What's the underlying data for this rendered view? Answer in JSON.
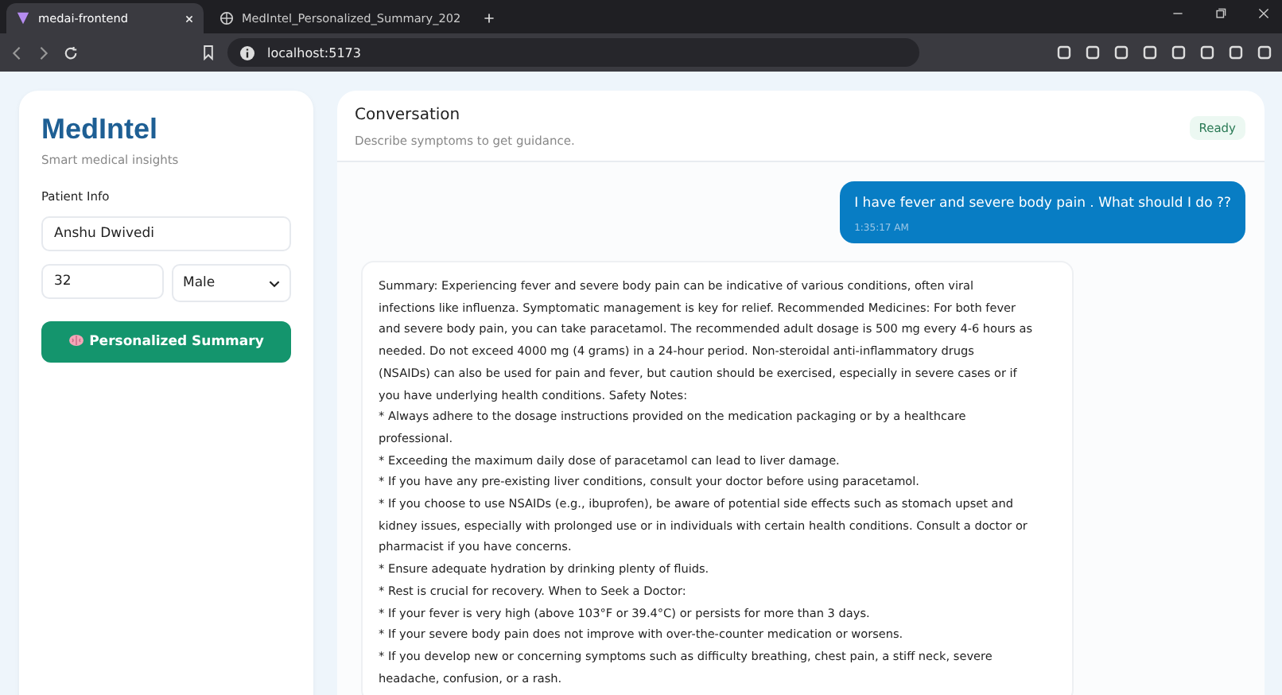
{
  "browser": {
    "tabs": [
      {
        "title": "medai-frontend",
        "selected": true
      },
      {
        "title": "MedIntel_Personalized_Summary_202",
        "selected": false
      }
    ],
    "address": "localhost:5173"
  },
  "sidebar": {
    "brand": "MedIntel",
    "tagline": "Smart medical insights",
    "section_label": "Patient Info",
    "name_value": "Anshu Dwivedi",
    "age_value": "32",
    "gender_value": "Male",
    "button_label": "Personalized Summary"
  },
  "conversation": {
    "title": "Conversation",
    "subtitle": "Describe symptoms to get guidance.",
    "status": "Ready",
    "messages": [
      {
        "kind": "user",
        "lines": [
          "I have fever and severe body pain . What should I do ??"
        ],
        "time": "1:35:17 AM"
      },
      {
        "kind": "assistant",
        "lines": [
          "Summary: Experiencing fever and severe body pain can be indicative of various conditions, often viral",
          "infections like influenza. Symptomatic management is key for relief. Recommended Medicines: For both fever",
          "and severe body pain, you can take paracetamol. The recommended adult dosage is 500 mg every 4-6 hours as",
          "needed. Do not exceed 4000 mg (4 grams) in a 24-hour period. Non-steroidal anti-inflammatory drugs",
          "(NSAIDs) can also be used for pain and fever, but caution should be exercised, especially in severe cases or if",
          "you have underlying health conditions. Safety Notes:",
          "* Always adhere to the dosage instructions provided on the medication packaging or by a healthcare",
          "professional.",
          "* Exceeding the maximum daily dose of paracetamol can lead to liver damage.",
          "* If you have any pre-existing liver conditions, consult your doctor before using paracetamol.",
          "* If you choose to use NSAIDs (e.g., ibuprofen), be aware of potential side effects such as stomach upset and",
          "kidney issues, especially with prolonged use or in individuals with certain health conditions. Consult a doctor or",
          "pharmacist if you have concerns.",
          "* Ensure adequate hydration by drinking plenty of fluids.",
          "* Rest is crucial for recovery. When to Seek a Doctor:",
          "* If your fever is very high (above 103°F or 39.4°C) or persists for more than 3 days.",
          "* If your severe body pain does not improve with over-the-counter medication or worsens.",
          "* If you develop new or concerning symptoms such as difficulty breathing, chest pain, a stiff neck, severe",
          "headache, confusion, or a rash."
        ]
      }
    ]
  }
}
